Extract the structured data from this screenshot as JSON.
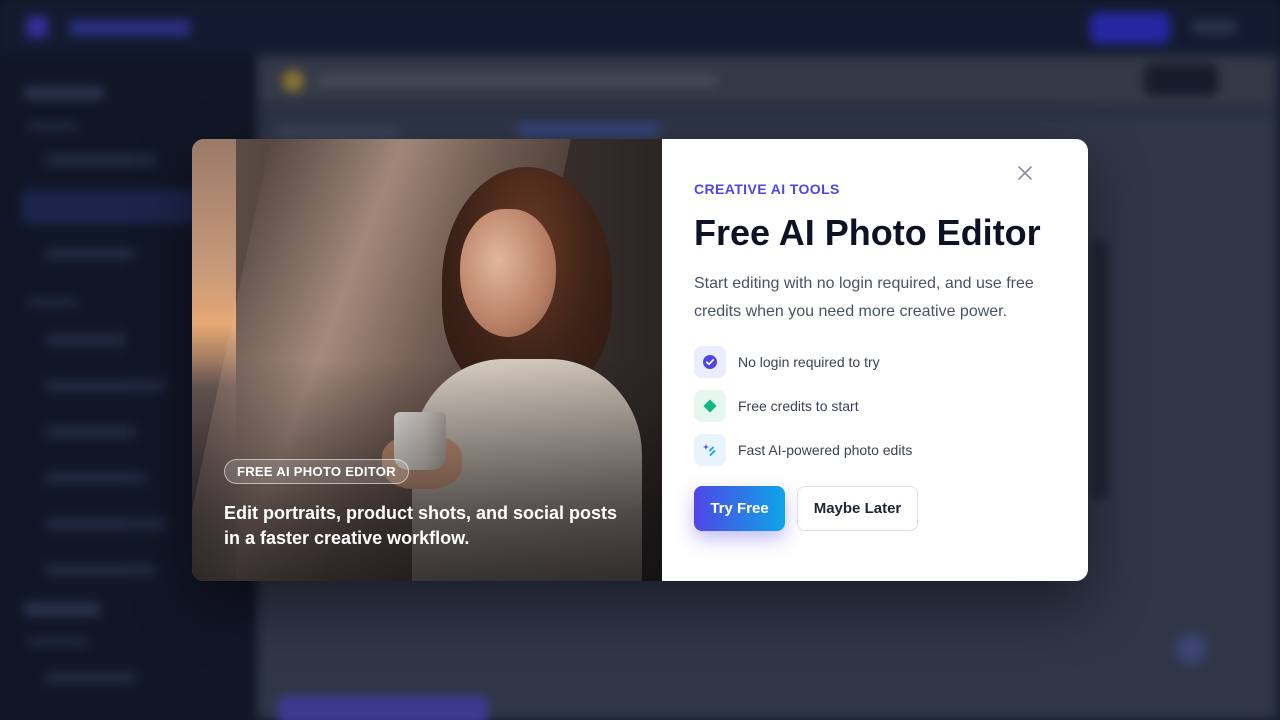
{
  "modal": {
    "eyebrow": "CREATIVE AI TOOLS",
    "title": "Free AI Photo Editor",
    "description": "Start editing with no login required, and use free credits when you need more creative power.",
    "features": [
      {
        "icon": "check-badge-icon",
        "text": "No login required to try",
        "color": "#4f46e5"
      },
      {
        "icon": "diamond-icon",
        "text": "Free credits to start",
        "color": "#10b981"
      },
      {
        "icon": "sparkle-icon",
        "text": "Fast AI-powered photo edits",
        "color": "#0ea5e9"
      }
    ],
    "primary_label": "Try Free",
    "secondary_label": "Maybe Later",
    "close_icon": "close-icon"
  },
  "hero": {
    "badge": "FREE AI PHOTO EDITOR",
    "caption": "Edit portraits, product shots, and social posts in a faster creative workflow."
  },
  "colors": {
    "accent": "#4f46e5",
    "accent_end": "#0ea5e9",
    "background": "#141a2c"
  }
}
